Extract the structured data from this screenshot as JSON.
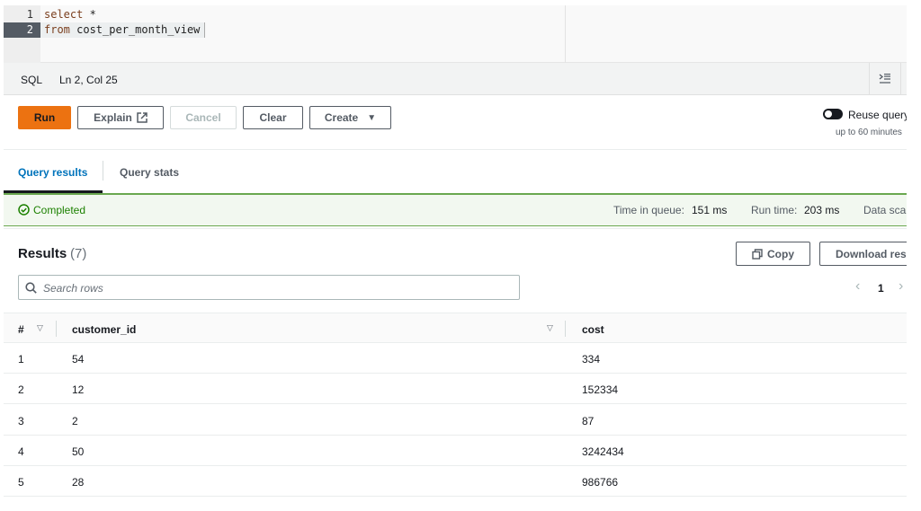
{
  "editor": {
    "lines": [
      {
        "number": "1",
        "keyword": "select",
        "rest": " *"
      },
      {
        "number": "2",
        "keyword": "from",
        "rest": " cost_per_month_view"
      }
    ]
  },
  "status_bar": {
    "language": "SQL",
    "cursor": "Ln 2, Col 25",
    "format_icon": "format-indent-icon"
  },
  "toolbar": {
    "run": "Run",
    "explain": "Explain",
    "cancel": "Cancel",
    "clear": "Clear",
    "create": "Create",
    "reuse_label": "Reuse query",
    "reuse_sub": "up to 60 minutes",
    "reuse_enabled": false
  },
  "tabs": [
    {
      "label": "Query results",
      "active": true
    },
    {
      "label": "Query stats",
      "active": false
    }
  ],
  "query_status": {
    "state": "Completed",
    "queue_label": "Time in queue:",
    "queue_value": "151 ms",
    "run_label": "Run time:",
    "run_value": "203 ms",
    "scan_label": "Data sca"
  },
  "results": {
    "title": "Results",
    "count": "(7)",
    "copy": "Copy",
    "download": "Download res",
    "search_placeholder": "Search rows",
    "page": "1",
    "columns": [
      "#",
      "customer_id",
      "cost"
    ],
    "rows": [
      [
        "1",
        "54",
        "334"
      ],
      [
        "2",
        "12",
        "152334"
      ],
      [
        "3",
        "2",
        "87"
      ],
      [
        "4",
        "50",
        "3242434"
      ],
      [
        "5",
        "28",
        "986766"
      ]
    ]
  },
  "colors": {
    "primary": "#ec7211",
    "tab_active": "#0073bb",
    "success": "#1d8102"
  }
}
